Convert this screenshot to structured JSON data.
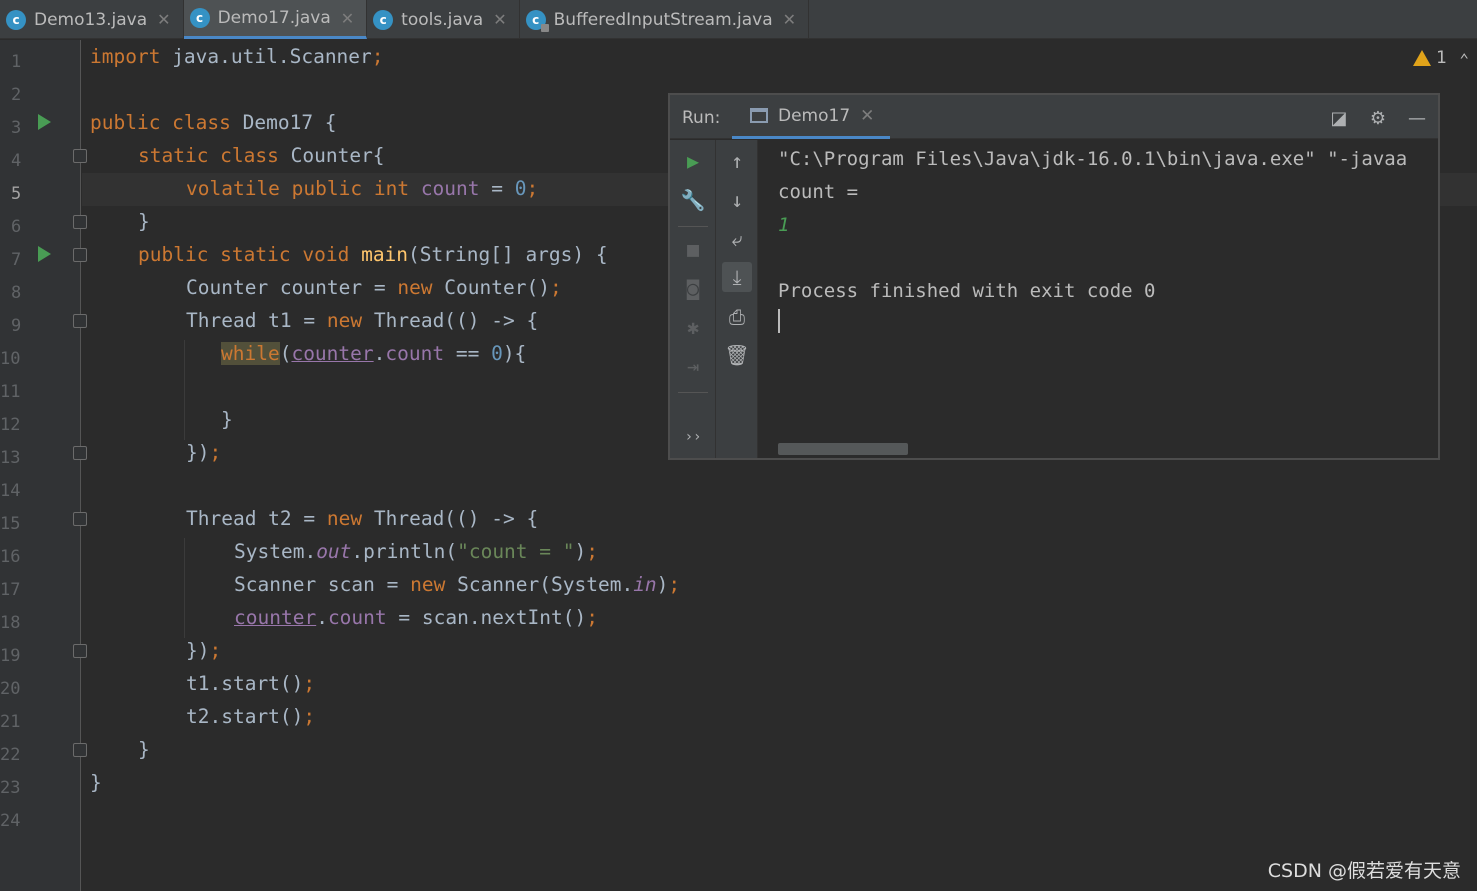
{
  "tabs": [
    {
      "name": "Demo13.java",
      "active": false,
      "locked": false
    },
    {
      "name": "Demo17.java",
      "active": true,
      "locked": false
    },
    {
      "name": "tools.java",
      "active": false,
      "locked": false
    },
    {
      "name": "BufferedInputStream.java",
      "active": false,
      "locked": true
    }
  ],
  "tab_close": "✕",
  "line_numbers": [
    "1",
    "2",
    "3",
    "4",
    "5",
    "6",
    "7",
    "8",
    "9",
    "10",
    "11",
    "12",
    "13",
    "14",
    "15",
    "16",
    "17",
    "18",
    "19",
    "20",
    "21",
    "22",
    "23",
    "24"
  ],
  "code": {
    "l1": {
      "kw": "import",
      "rest": " java.util.Scanner",
      "semi": ";"
    },
    "l3": {
      "kw": "public class",
      "rest": " Demo17 {"
    },
    "l4": {
      "kw": "static class",
      "rest": " Counter{"
    },
    "l5": {
      "kw1": "volatile public int",
      "fld": "count",
      "eq": " = ",
      "num": "0",
      "semi": ";"
    },
    "l6": "}",
    "l7": {
      "kw": "public static void",
      "mth": "main",
      "rest": "(String[] args) {"
    },
    "l8": {
      "a": "Counter counter = ",
      "kw": "new",
      "b": " Counter()",
      "semi": ";"
    },
    "l9": {
      "a": "Thread t1 = ",
      "kw": "new",
      "b": " Thread(() -> {"
    },
    "l10": {
      "kw": "while",
      "p": "(",
      "ul": "counter",
      "dot": ".",
      "fld": "count",
      "eq": " == ",
      "num": "0",
      "end": "){"
    },
    "l12": "}",
    "l13": {
      "a": "})",
      "semi": ";"
    },
    "l15": {
      "a": "Thread t2 = ",
      "kw": "new",
      "b": " Thread(() -> {"
    },
    "l16": {
      "a": "System.",
      "it": "out",
      "b": ".println(",
      "str": "\"count = \"",
      "c": ")",
      "semi": ";"
    },
    "l17": {
      "a": "Scanner scan = ",
      "kw": "new",
      "b": " Scanner(System.",
      "it": "in",
      "c": ")",
      "semi": ";"
    },
    "l18": {
      "ul": "counter",
      "dot": ".",
      "fld": "count",
      "b": " = scan.nextInt()",
      "semi": ";"
    },
    "l19": {
      "a": "})",
      "semi": ";"
    },
    "l20": {
      "a": "t1.start()",
      "semi": ";"
    },
    "l21": {
      "a": "t2.start()",
      "semi": ";"
    },
    "l22": "}",
    "l23": "}"
  },
  "inspection": {
    "warnings": "1"
  },
  "run_panel": {
    "label": "Run:",
    "tab": "Demo17",
    "console": [
      "\"C:\\Program Files\\Java\\jdk-16.0.1\\bin\\java.exe\" \"-javaa",
      "count =",
      "1",
      "",
      "Process finished with exit code 0"
    ]
  },
  "watermark": "CSDN @假若爱有天意",
  "colors": {
    "keyword": "#cc7832",
    "number": "#6897bb",
    "field": "#9876aa",
    "string": "#6a8759",
    "method": "#ffc66d",
    "run_green": "#499c54"
  }
}
